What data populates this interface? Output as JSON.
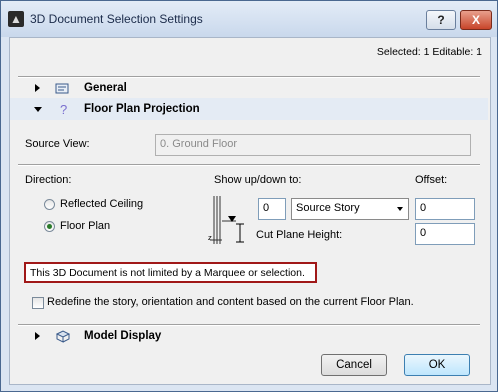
{
  "window": {
    "title": "3D Document Selection Settings",
    "help_label": "?",
    "close_label": "X"
  },
  "status": {
    "selected_text": "Selected: 1 Editable: 1"
  },
  "sections": {
    "general": "General",
    "floor_plan_projection": "Floor Plan Projection",
    "model_display": "Model Display"
  },
  "source_view": {
    "label": "Source View:",
    "value": "0. Ground Floor"
  },
  "direction": {
    "label": "Direction:",
    "options": [
      "Reflected Ceiling",
      "Floor Plan"
    ],
    "selected": "Floor Plan"
  },
  "show_up_down": {
    "label": "Show up/down to:",
    "value": "0",
    "story_select": "Source Story"
  },
  "offset": {
    "label": "Offset:",
    "value": "0"
  },
  "cut_plane": {
    "label": "Cut Plane Height:",
    "value": "0"
  },
  "warning_text": "This 3D Document is not limited by a Marquee or selection.",
  "redefine_checkbox": {
    "label": "Redefine the story, orientation and content based on the current Floor Plan.",
    "checked": false
  },
  "buttons": {
    "cancel": "Cancel",
    "ok": "OK"
  }
}
